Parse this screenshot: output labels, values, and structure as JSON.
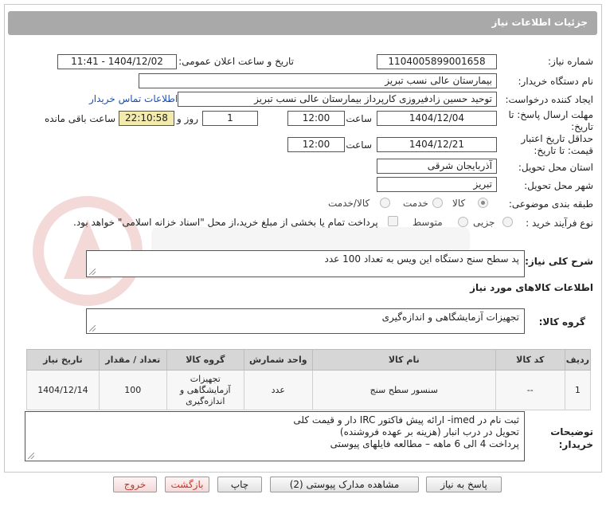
{
  "header": {
    "title": "جزئیات اطلاعات نیاز"
  },
  "fields": {
    "need_number_label": "شماره نیاز:",
    "need_number": "1104005899001658",
    "announce_label": "تاریخ و ساعت اعلان عمومی:",
    "announce_value": "1404/12/02 - 11:41",
    "buyer_org_label": "نام دستگاه خریدار:",
    "buyer_org": "بیمارستان عالی نسب تبریز",
    "requester_label": "ایجاد کننده درخواست:",
    "requester": "توحید حسین زادفیروزی کارپرداز بیمارستان عالی نسب تبریز",
    "contact_link": "اطلاعات تماس خریدار",
    "deadline_label": "مهلت ارسال پاسخ: تا تاریخ:",
    "deadline_date": "1404/12/04",
    "time_label": "ساعت",
    "deadline_time": "12:00",
    "days_value": "1",
    "day_and_label": "روز و",
    "remaining_time": "22:10:58",
    "remaining_label": "ساعت باقی مانده",
    "validity_label": "حداقل تاریخ اعتبار قیمت: تا تاریخ:",
    "validity_date": "1404/12/21",
    "validity_time": "12:00",
    "province_label": "استان محل تحویل:",
    "province": "آذربایجان شرقی",
    "city_label": "شهر محل تحویل:",
    "city": "تبریز",
    "category_label": "طبقه بندی موضوعی:",
    "category_options": [
      "کالا",
      "خدمت",
      "کالا/خدمت"
    ],
    "process_label": "نوع فرآیند خرید :",
    "process_options": [
      "جزیی",
      "متوسط"
    ],
    "treasury_text": "پرداخت تمام یا بخشی از مبلغ خرید،از محل \"اسناد خزانه اسلامی\" خواهد بود."
  },
  "description": {
    "label": "شرح کلی نیاز:",
    "text": "پد سطح سنج دستگاه این ویس به تعداد 100 عدد"
  },
  "goods_section": {
    "title": "اطلاعات کالاهای مورد نیاز",
    "group_label": "گروه کالا:",
    "group_value": "تجهیزات آزمایشگاهی و اندازه‌گیری"
  },
  "table": {
    "headers": [
      "ردیف",
      "کد کالا",
      "نام کالا",
      "واحد شمارش",
      "گروه کالا",
      "تعداد / مقدار",
      "تاریخ نیاز"
    ],
    "rows": [
      [
        "1",
        "--",
        "سنسور سطح سنج",
        "عدد",
        "تجهیزات آزمایشگاهی و اندازه‌گیری",
        "100",
        "1404/12/14"
      ]
    ]
  },
  "buyer_notes": {
    "label": "توضیحات خریدار:",
    "lines": [
      "ثبت نام در imed- ارائه پیش فاکتور IRC دار و قیمت کلی",
      "تحویل در درب انبار (هزینه بر عهده فروشنده)",
      "پرداخت  4 الی 6 ماهه – مطالعه فایلهای پیوستی"
    ]
  },
  "buttons": {
    "reply": "پاسخ به نیاز",
    "docs": "مشاهده مدارک پیوستی (2)",
    "print": "چاپ",
    "back": "بازگشت",
    "exit": "خروج"
  },
  "colors": {
    "header_bg": "#a9a9a9",
    "highlight": "#f3eaae",
    "link": "#1a4fb3"
  }
}
